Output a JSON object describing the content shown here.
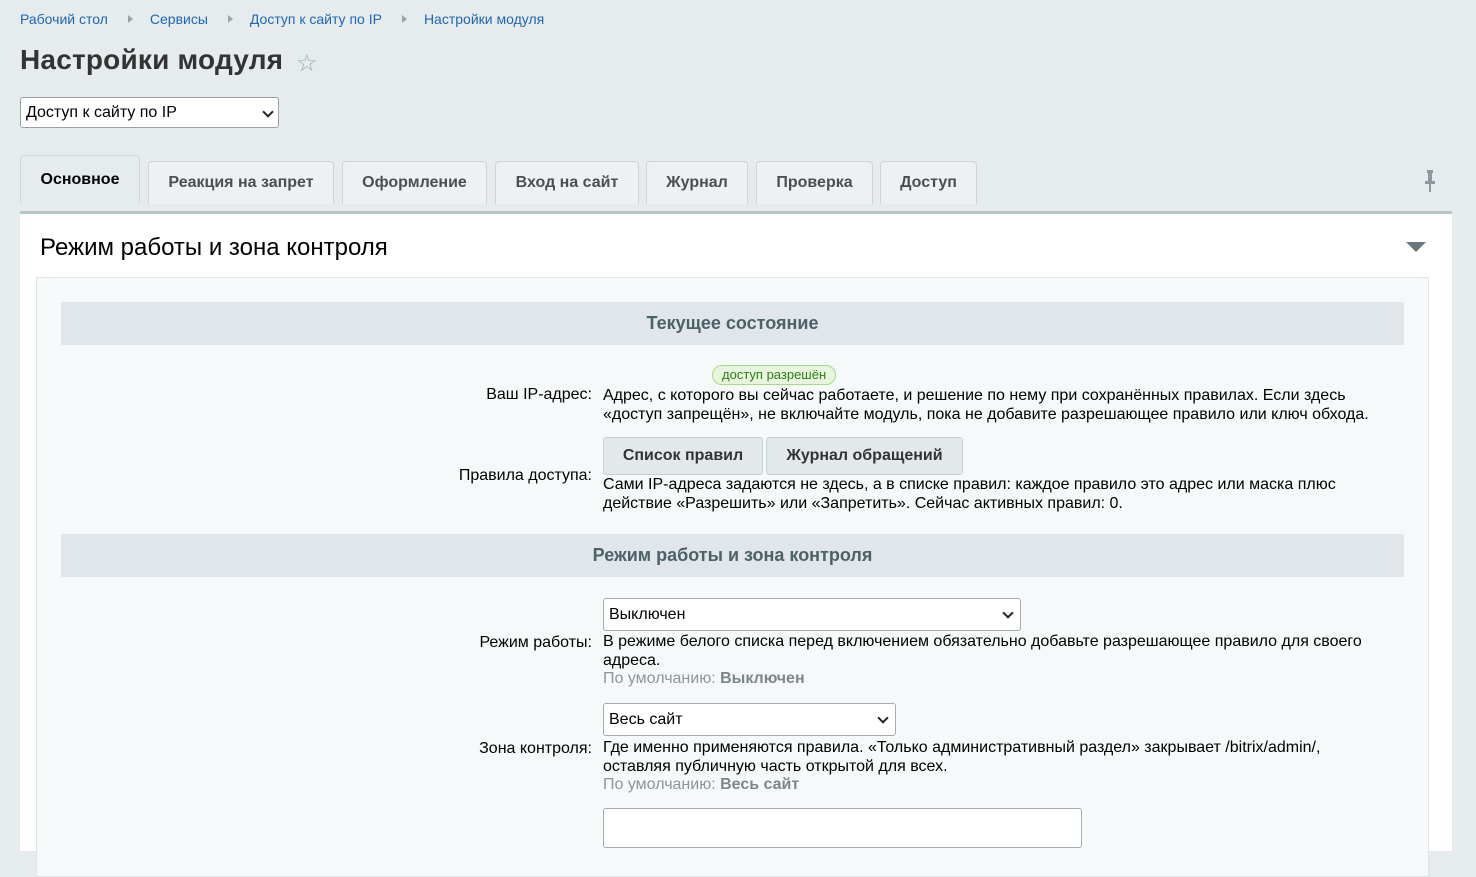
{
  "breadcrumb": [
    "Рабочий стол",
    "Сервисы",
    "Доступ к сайту по IP",
    "Настройки модуля"
  ],
  "page_title": "Настройки модуля",
  "module_select": {
    "value": "Доступ к сайту по IP"
  },
  "tabs": [
    {
      "label": "Основное",
      "active": true
    },
    {
      "label": "Реакция на запрет"
    },
    {
      "label": "Оформление"
    },
    {
      "label": "Вход на сайт"
    },
    {
      "label": "Журнал"
    },
    {
      "label": "Проверка"
    },
    {
      "label": "Доступ"
    }
  ],
  "panel": {
    "title": "Режим работы и зона контроля",
    "section_current": "Текущее состояние",
    "ip": {
      "label": "Ваш IP-адрес:",
      "badge": "доступ разрешён",
      "line1": "Адрес, с которого вы сейчас работаете, и решение по нему при сохранённых правилах. Если здесь",
      "line2": "«доступ запрещён», не включайте модуль, пока не добавите разрешающее правило или ключ обхода."
    },
    "rules": {
      "label": "Правила доступа:",
      "btn_list": "Список правил",
      "btn_log": "Журнал обращений",
      "line1": "Сами IP-адреса задаются не здесь, а в списке правил: каждое правило это адрес или маска плюс",
      "line2": "действие «Разрешить» или «Запретить». Сейчас активных правил: 0."
    },
    "section_mode": "Режим работы и зона контроля",
    "mode": {
      "label": "Режим работы:",
      "value": "Выключен",
      "line1": "В режиме белого списка перед включением обязательно добавьте разрешающее правило для своего",
      "line2": "адреса.",
      "default_prefix": "По умолчанию:",
      "default_value": "Выключен"
    },
    "zone": {
      "label": "Зона контроля:",
      "value": "Весь сайт",
      "line1": "Где именно применяются правила. «Только административный раздел» закрывает /bitrix/admin/,",
      "line2": "оставляя публичную часть открытой для всех.",
      "default_prefix": "По умолчанию:",
      "default_value": "Весь сайт"
    }
  },
  "colors": {
    "link": "#2067b0",
    "badge_green": "#2e7d1a",
    "section_bg": "#e0e6e9"
  }
}
